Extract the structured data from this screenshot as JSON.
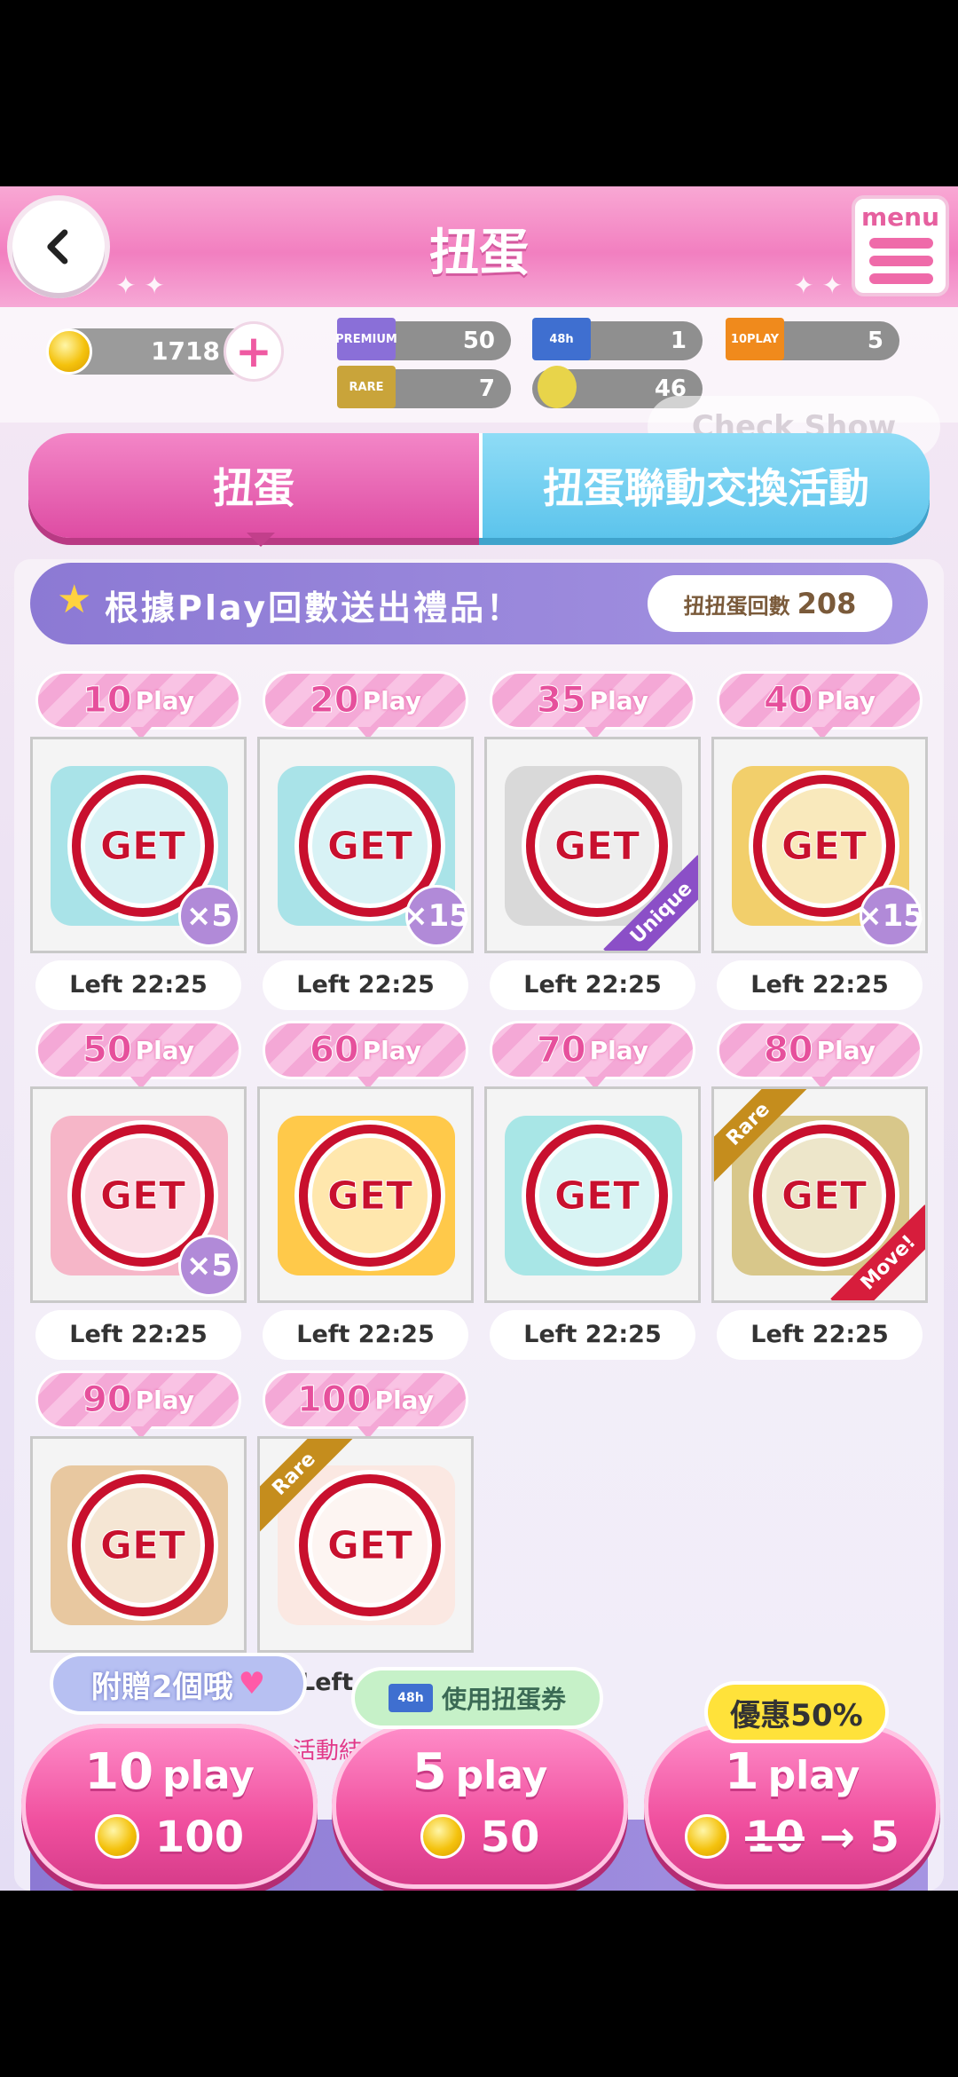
{
  "header": {
    "title": "扭蛋",
    "menu_label": "menu"
  },
  "currency": {
    "coins": "1718",
    "tickets": [
      {
        "icon": "premium-ticket-icon",
        "label": "PREMIUM",
        "value": "50",
        "color": "#8a6fd8"
      },
      {
        "icon": "48h-ticket-icon",
        "label": "48h",
        "value": "1",
        "color": "#3f6fd0"
      },
      {
        "icon": "10play-ticket-icon",
        "label": "10PLAY",
        "value": "5",
        "color": "#f08a1c"
      },
      {
        "icon": "rare-ticket-icon",
        "label": "RARE",
        "value": "7",
        "color": "#c9a43a"
      },
      {
        "icon": "gem-icon",
        "label": "",
        "value": "46",
        "color": "#e8d44a"
      }
    ],
    "check_show": "Check Show"
  },
  "tabs": {
    "gacha": "扭蛋",
    "exchange": "扭蛋聯動交換活動"
  },
  "banner": {
    "text": "根據Play回數送出禮品！",
    "count_label": "扭扭蛋回數",
    "count_value": "208"
  },
  "rewards": [
    {
      "num": "10",
      "unit": "Play",
      "get": "GET",
      "qty": "×5",
      "ribbon": "",
      "left": "Left 22:25",
      "art_color": "#a9e3e8"
    },
    {
      "num": "20",
      "unit": "Play",
      "get": "GET",
      "qty": "×15",
      "ribbon": "",
      "left": "Left 22:25",
      "art_color": "#a9e3e8"
    },
    {
      "num": "35",
      "unit": "Play",
      "get": "GET",
      "qty": "",
      "ribbon": "Unique",
      "left": "Left 22:25",
      "art_color": "#d9d9d9"
    },
    {
      "num": "40",
      "unit": "Play",
      "get": "GET",
      "qty": "×15",
      "ribbon": "",
      "left": "Left 22:25",
      "art_color": "#f2cf6b"
    },
    {
      "num": "50",
      "unit": "Play",
      "get": "GET",
      "qty": "×5",
      "ribbon": "",
      "left": "Left 22:25",
      "art_color": "#f6b6c8"
    },
    {
      "num": "60",
      "unit": "Play",
      "get": "GET",
      "qty": "",
      "ribbon": "",
      "left": "Left 22:25",
      "art_color": "#ffc94a"
    },
    {
      "num": "70",
      "unit": "Play",
      "get": "GET",
      "qty": "",
      "ribbon": "",
      "left": "Left 22:25",
      "art_color": "#a8e6e6"
    },
    {
      "num": "80",
      "unit": "Play",
      "get": "GET",
      "qty": "",
      "ribbon": "Rare",
      "ribbon2": "Move!",
      "left": "Left 22:25",
      "art_color": "#d8c78a"
    },
    {
      "num": "90",
      "unit": "Play",
      "get": "GET",
      "qty": "",
      "ribbon": "",
      "left": "",
      "art_color": "#e8c8a0"
    },
    {
      "num": "100",
      "unit": "Play",
      "get": "GET",
      "qty": "",
      "ribbon": "Rare",
      "left": "",
      "art_color": "#fbe8e2"
    }
  ],
  "partial_left": "Left 2",
  "notice": "活動結束後不顯示",
  "buttons": {
    "ten": {
      "plays": "10",
      "unit": "play",
      "cost": "100",
      "bubble": "附贈2個哦"
    },
    "five": {
      "plays": "5",
      "unit": "play",
      "cost": "50",
      "bubble": "使用扭蛋券",
      "ticket": "48h"
    },
    "one": {
      "plays": "1",
      "unit": "play",
      "old_cost": "10",
      "arrow": "→",
      "cost": "5",
      "bubble": "優惠50%"
    }
  }
}
